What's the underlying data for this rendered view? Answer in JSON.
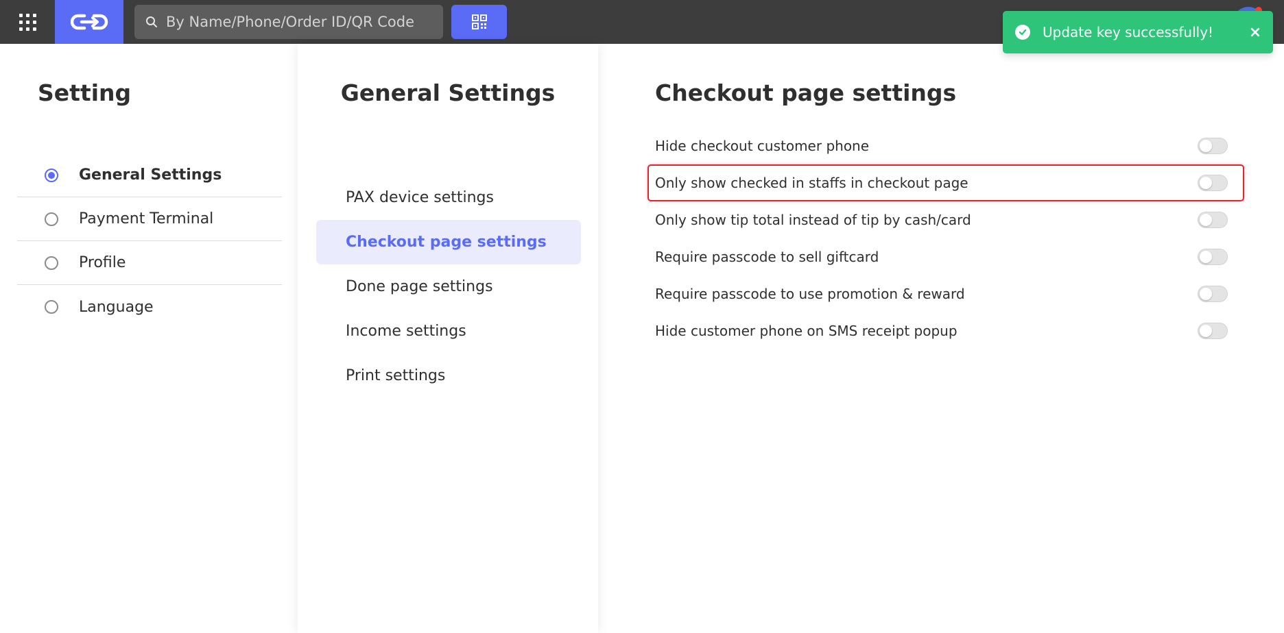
{
  "topbar": {
    "apps_icon": "grid-icon",
    "logo_icon": "link-logo-icon",
    "search_placeholder": "By Name/Phone/Order ID/QR Code",
    "search_value": "",
    "qr_icon": "qr-code-icon"
  },
  "toast": {
    "message": "Update key successfully!",
    "close_label": "×",
    "color": "#2ec47a"
  },
  "left": {
    "title": "Setting",
    "items": [
      {
        "label": "General Settings",
        "selected": true
      },
      {
        "label": "Payment Terminal",
        "selected": false
      },
      {
        "label": "Profile",
        "selected": false
      },
      {
        "label": "Language",
        "selected": false
      }
    ]
  },
  "middle": {
    "title": "General Settings",
    "items": [
      {
        "label": "PAX device settings"
      },
      {
        "label": "Checkout page settings",
        "active": true
      },
      {
        "label": "Done page settings"
      },
      {
        "label": "Income settings"
      },
      {
        "label": "Print settings"
      }
    ]
  },
  "right": {
    "title": "Checkout page settings",
    "settings": [
      {
        "label": "Hide checkout customer phone",
        "enabled": false
      },
      {
        "label": "Only show checked in staffs in checkout page",
        "enabled": false
      },
      {
        "label": "Only show tip total instead of tip by cash/card",
        "enabled": false
      },
      {
        "label": "Require passcode to sell giftcard",
        "enabled": false
      },
      {
        "label": "Require passcode to use promotion & reward",
        "enabled": false
      },
      {
        "label": "Hide customer phone on SMS receipt popup",
        "enabled": false
      }
    ]
  },
  "colors": {
    "accent": "#5a6cf5",
    "topbar": "#3d3d3d",
    "highlight_border": "#e0262f"
  }
}
